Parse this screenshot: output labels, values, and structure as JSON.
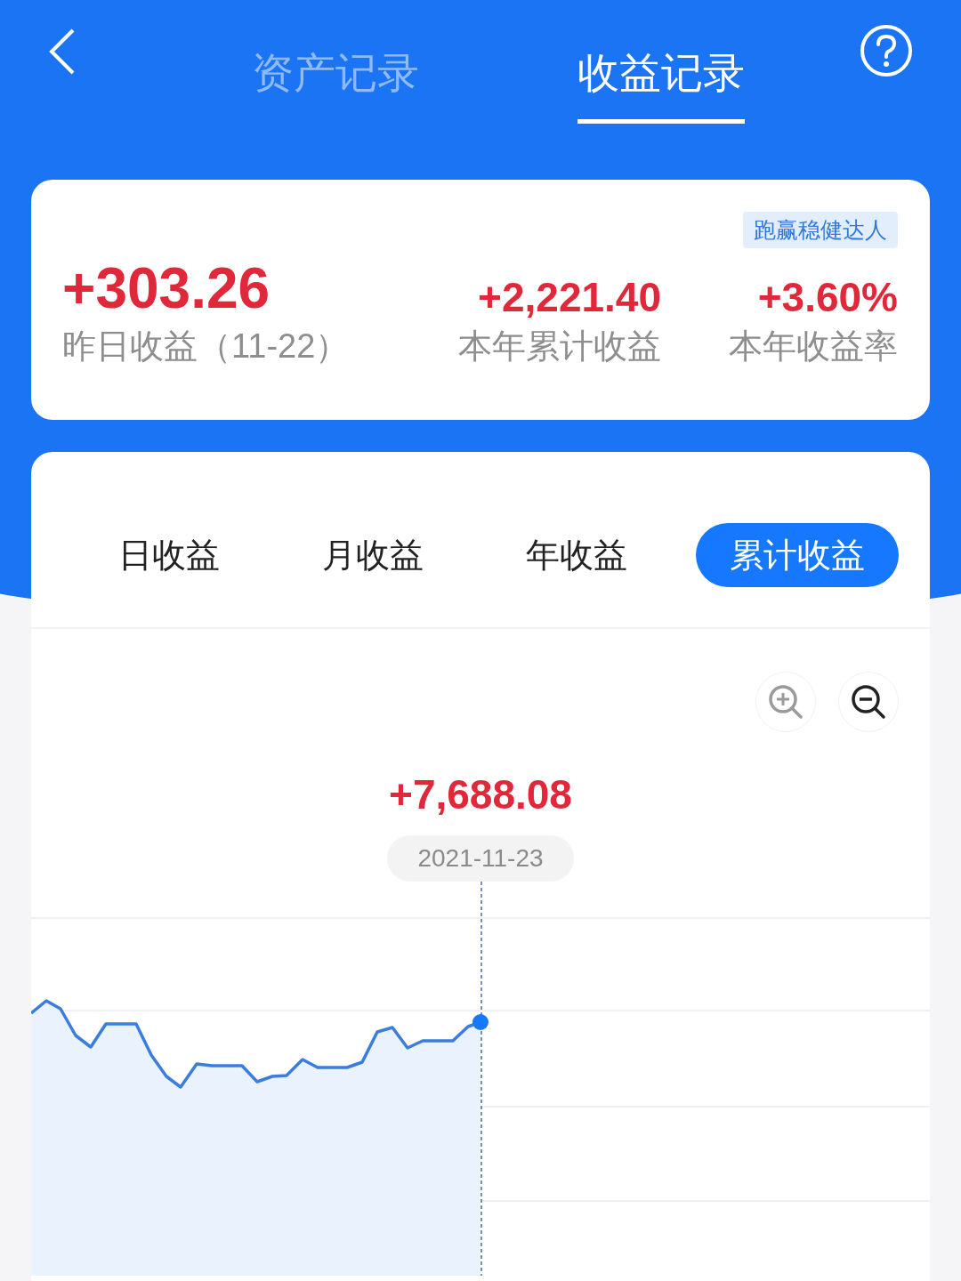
{
  "header": {
    "tabs": [
      {
        "label": "资产记录",
        "selected": false
      },
      {
        "label": "收益记录",
        "selected": true
      }
    ]
  },
  "summary": {
    "badge": "跑赢稳健达人",
    "stats": [
      {
        "value": "+303.26",
        "label": "昨日收益（11-22）"
      },
      {
        "value": "+2,221.40",
        "label": "本年累计收益"
      },
      {
        "value": "+3.60%",
        "label": "本年收益率"
      }
    ]
  },
  "chart_panel": {
    "periods": [
      {
        "label": "日收益",
        "selected": false
      },
      {
        "label": "月收益",
        "selected": false
      },
      {
        "label": "年收益",
        "selected": false
      },
      {
        "label": "累计收益",
        "selected": true
      }
    ],
    "zoom_buttons": [
      {
        "kind": "in",
        "disabled": true
      },
      {
        "kind": "out",
        "disabled": false
      }
    ],
    "tooltip": {
      "value": "+7,688.08",
      "date": "2021-11-23"
    }
  }
}
